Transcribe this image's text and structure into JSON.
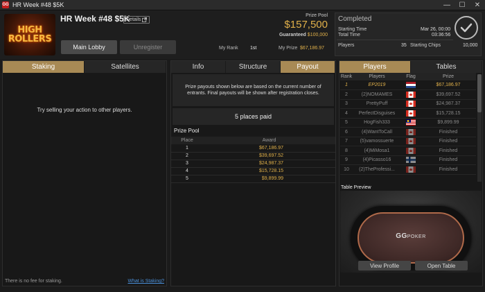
{
  "window": {
    "title": "HR Week #48 $5K",
    "app_icon": "GG",
    "controls": [
      "—",
      "☐",
      "✕"
    ]
  },
  "header": {
    "logo_line1": "HIGH",
    "logo_line2": "ROLLERS",
    "tournament_name": "HR Week #48 $5K",
    "details_label": "Details",
    "main_lobby_label": "Main Lobby",
    "unregister_label": "Unregister",
    "prize_pool_label": "Prize Pool",
    "prize_pool_value": "$157,500",
    "guaranteed_label": "Guaranteed",
    "guaranteed_value": "$100,000",
    "my_rank_label": "My Rank",
    "my_rank_value": "1st",
    "my_prize_label": "My Prize",
    "my_prize_value": "$67,186.97"
  },
  "status": {
    "state": "Completed",
    "starting_time_label": "Starting Time",
    "starting_time_value": "Mar 26, 00:00",
    "total_time_label": "Total Time",
    "total_time_value": "03:36:56",
    "players_label": "Players",
    "players_value": "35",
    "starting_chips_label": "Starting Chips",
    "starting_chips_value": "10,000"
  },
  "left_panel": {
    "tabs": [
      "Staking",
      "Satellites"
    ],
    "message": "Try selling your action to other players.",
    "footer_text": "There is no fee for staking.",
    "footer_link": "What is Staking?"
  },
  "middle_panel": {
    "tabs": [
      "Info",
      "Structure",
      "Payout"
    ],
    "note": "Prize payouts shown below are based on the current number of entrants. Final payouts will be shown after registration closes.",
    "places_paid": "5 places paid",
    "prize_pool_title": "Prize Pool",
    "columns": [
      "Place",
      "Award"
    ],
    "rows": [
      [
        "1",
        "$67,186.97"
      ],
      [
        "2",
        "$39,697.52"
      ],
      [
        "3",
        "$24,987.37"
      ],
      [
        "4",
        "$15,728.15"
      ],
      [
        "5",
        "$9,899.99"
      ]
    ]
  },
  "right_panel": {
    "tabs": [
      "Players",
      "Tables"
    ],
    "columns": [
      "Rank",
      "Players",
      "Flag",
      "Prize"
    ],
    "rows": [
      [
        "1",
        "EP2019",
        "$67,186.97"
      ],
      [
        "2",
        "(2)NOMAMES",
        "$39,697.52"
      ],
      [
        "3",
        "PrettyPuff",
        "$24,987.37"
      ],
      [
        "4",
        "PerfectDisguises",
        "$15,728.15"
      ],
      [
        "5",
        "HogFish333",
        "$9,899.99"
      ],
      [
        "6",
        "(4)WantToCall",
        "Finished"
      ],
      [
        "7",
        "(5)vamossuerte",
        "Finished"
      ],
      [
        "8",
        "(4)MiMosa1",
        "Finished"
      ],
      [
        "9",
        "(4)Picasso16",
        "Finished"
      ],
      [
        "10",
        "(2)TheProfessi...",
        "Finished"
      ]
    ],
    "table_preview_label": "Table Preview",
    "brand": "GG",
    "brand_suffix": "POKER",
    "view_profile_label": "View Profile",
    "open_table_label": "Open Table"
  },
  "colors": {
    "accent_tab": "#a88a55",
    "gold": "#e0b04a",
    "link": "#4a8fd8"
  }
}
